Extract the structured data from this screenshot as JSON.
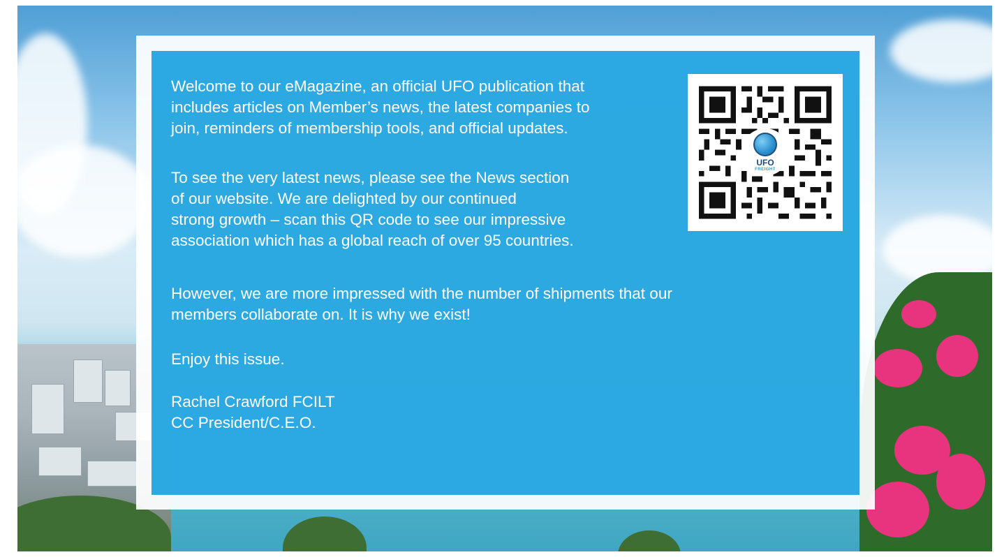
{
  "letter": {
    "paragraph1": "Welcome to our eMagazine, an official UFO publication that\nincludes articles on Member’s news, the latest companies to\njoin, reminders of membership tools, and official updates.",
    "paragraph2": "To see the very latest news, please see the News section\nof our website. We are delighted by our continued\nstrong growth – scan this QR code to see our impressive\nassociation which has a global reach of over 95 countries.",
    "paragraph3": "However, we are more impressed with the number of shipments that our\nmembers collaborate on. It is why we exist!",
    "paragraph4": "Enjoy this issue.",
    "signature_name": "Rachel Crawford FCILT",
    "signature_title": "CC President/C.E.O."
  },
  "qr": {
    "logo_text": "UFO",
    "logo_subtext": "FREIGHT"
  },
  "colors": {
    "panel_blue": "#16a0df",
    "text": "#ffffff",
    "logo_navy": "#1d4b79"
  }
}
